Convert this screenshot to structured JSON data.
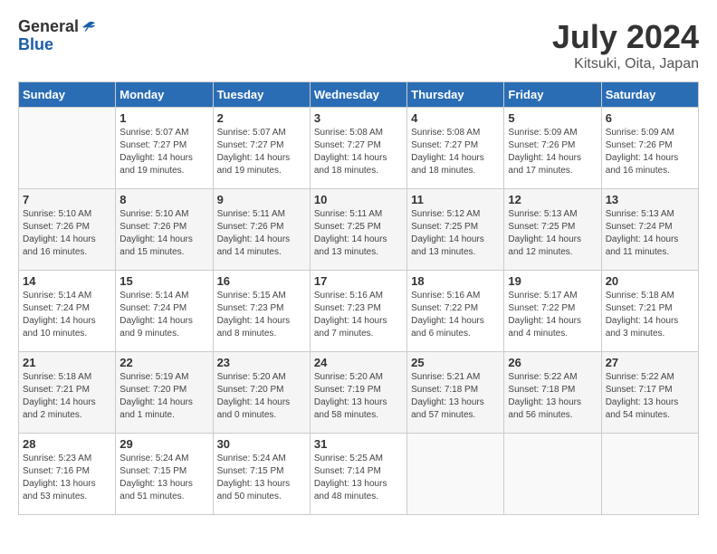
{
  "header": {
    "logo_general": "General",
    "logo_blue": "Blue",
    "title": "July 2024",
    "location": "Kitsuki, Oita, Japan"
  },
  "calendar": {
    "days_of_week": [
      "Sunday",
      "Monday",
      "Tuesday",
      "Wednesday",
      "Thursday",
      "Friday",
      "Saturday"
    ],
    "weeks": [
      [
        {
          "day": "",
          "info": ""
        },
        {
          "day": "1",
          "info": "Sunrise: 5:07 AM\nSunset: 7:27 PM\nDaylight: 14 hours\nand 19 minutes."
        },
        {
          "day": "2",
          "info": "Sunrise: 5:07 AM\nSunset: 7:27 PM\nDaylight: 14 hours\nand 19 minutes."
        },
        {
          "day": "3",
          "info": "Sunrise: 5:08 AM\nSunset: 7:27 PM\nDaylight: 14 hours\nand 18 minutes."
        },
        {
          "day": "4",
          "info": "Sunrise: 5:08 AM\nSunset: 7:27 PM\nDaylight: 14 hours\nand 18 minutes."
        },
        {
          "day": "5",
          "info": "Sunrise: 5:09 AM\nSunset: 7:26 PM\nDaylight: 14 hours\nand 17 minutes."
        },
        {
          "day": "6",
          "info": "Sunrise: 5:09 AM\nSunset: 7:26 PM\nDaylight: 14 hours\nand 16 minutes."
        }
      ],
      [
        {
          "day": "7",
          "info": "Sunrise: 5:10 AM\nSunset: 7:26 PM\nDaylight: 14 hours\nand 16 minutes."
        },
        {
          "day": "8",
          "info": "Sunrise: 5:10 AM\nSunset: 7:26 PM\nDaylight: 14 hours\nand 15 minutes."
        },
        {
          "day": "9",
          "info": "Sunrise: 5:11 AM\nSunset: 7:26 PM\nDaylight: 14 hours\nand 14 minutes."
        },
        {
          "day": "10",
          "info": "Sunrise: 5:11 AM\nSunset: 7:25 PM\nDaylight: 14 hours\nand 13 minutes."
        },
        {
          "day": "11",
          "info": "Sunrise: 5:12 AM\nSunset: 7:25 PM\nDaylight: 14 hours\nand 13 minutes."
        },
        {
          "day": "12",
          "info": "Sunrise: 5:13 AM\nSunset: 7:25 PM\nDaylight: 14 hours\nand 12 minutes."
        },
        {
          "day": "13",
          "info": "Sunrise: 5:13 AM\nSunset: 7:24 PM\nDaylight: 14 hours\nand 11 minutes."
        }
      ],
      [
        {
          "day": "14",
          "info": "Sunrise: 5:14 AM\nSunset: 7:24 PM\nDaylight: 14 hours\nand 10 minutes."
        },
        {
          "day": "15",
          "info": "Sunrise: 5:14 AM\nSunset: 7:24 PM\nDaylight: 14 hours\nand 9 minutes."
        },
        {
          "day": "16",
          "info": "Sunrise: 5:15 AM\nSunset: 7:23 PM\nDaylight: 14 hours\nand 8 minutes."
        },
        {
          "day": "17",
          "info": "Sunrise: 5:16 AM\nSunset: 7:23 PM\nDaylight: 14 hours\nand 7 minutes."
        },
        {
          "day": "18",
          "info": "Sunrise: 5:16 AM\nSunset: 7:22 PM\nDaylight: 14 hours\nand 6 minutes."
        },
        {
          "day": "19",
          "info": "Sunrise: 5:17 AM\nSunset: 7:22 PM\nDaylight: 14 hours\nand 4 minutes."
        },
        {
          "day": "20",
          "info": "Sunrise: 5:18 AM\nSunset: 7:21 PM\nDaylight: 14 hours\nand 3 minutes."
        }
      ],
      [
        {
          "day": "21",
          "info": "Sunrise: 5:18 AM\nSunset: 7:21 PM\nDaylight: 14 hours\nand 2 minutes."
        },
        {
          "day": "22",
          "info": "Sunrise: 5:19 AM\nSunset: 7:20 PM\nDaylight: 14 hours\nand 1 minute."
        },
        {
          "day": "23",
          "info": "Sunrise: 5:20 AM\nSunset: 7:20 PM\nDaylight: 14 hours\nand 0 minutes."
        },
        {
          "day": "24",
          "info": "Sunrise: 5:20 AM\nSunset: 7:19 PM\nDaylight: 13 hours\nand 58 minutes."
        },
        {
          "day": "25",
          "info": "Sunrise: 5:21 AM\nSunset: 7:18 PM\nDaylight: 13 hours\nand 57 minutes."
        },
        {
          "day": "26",
          "info": "Sunrise: 5:22 AM\nSunset: 7:18 PM\nDaylight: 13 hours\nand 56 minutes."
        },
        {
          "day": "27",
          "info": "Sunrise: 5:22 AM\nSunset: 7:17 PM\nDaylight: 13 hours\nand 54 minutes."
        }
      ],
      [
        {
          "day": "28",
          "info": "Sunrise: 5:23 AM\nSunset: 7:16 PM\nDaylight: 13 hours\nand 53 minutes."
        },
        {
          "day": "29",
          "info": "Sunrise: 5:24 AM\nSunset: 7:15 PM\nDaylight: 13 hours\nand 51 minutes."
        },
        {
          "day": "30",
          "info": "Sunrise: 5:24 AM\nSunset: 7:15 PM\nDaylight: 13 hours\nand 50 minutes."
        },
        {
          "day": "31",
          "info": "Sunrise: 5:25 AM\nSunset: 7:14 PM\nDaylight: 13 hours\nand 48 minutes."
        },
        {
          "day": "",
          "info": ""
        },
        {
          "day": "",
          "info": ""
        },
        {
          "day": "",
          "info": ""
        }
      ]
    ]
  }
}
